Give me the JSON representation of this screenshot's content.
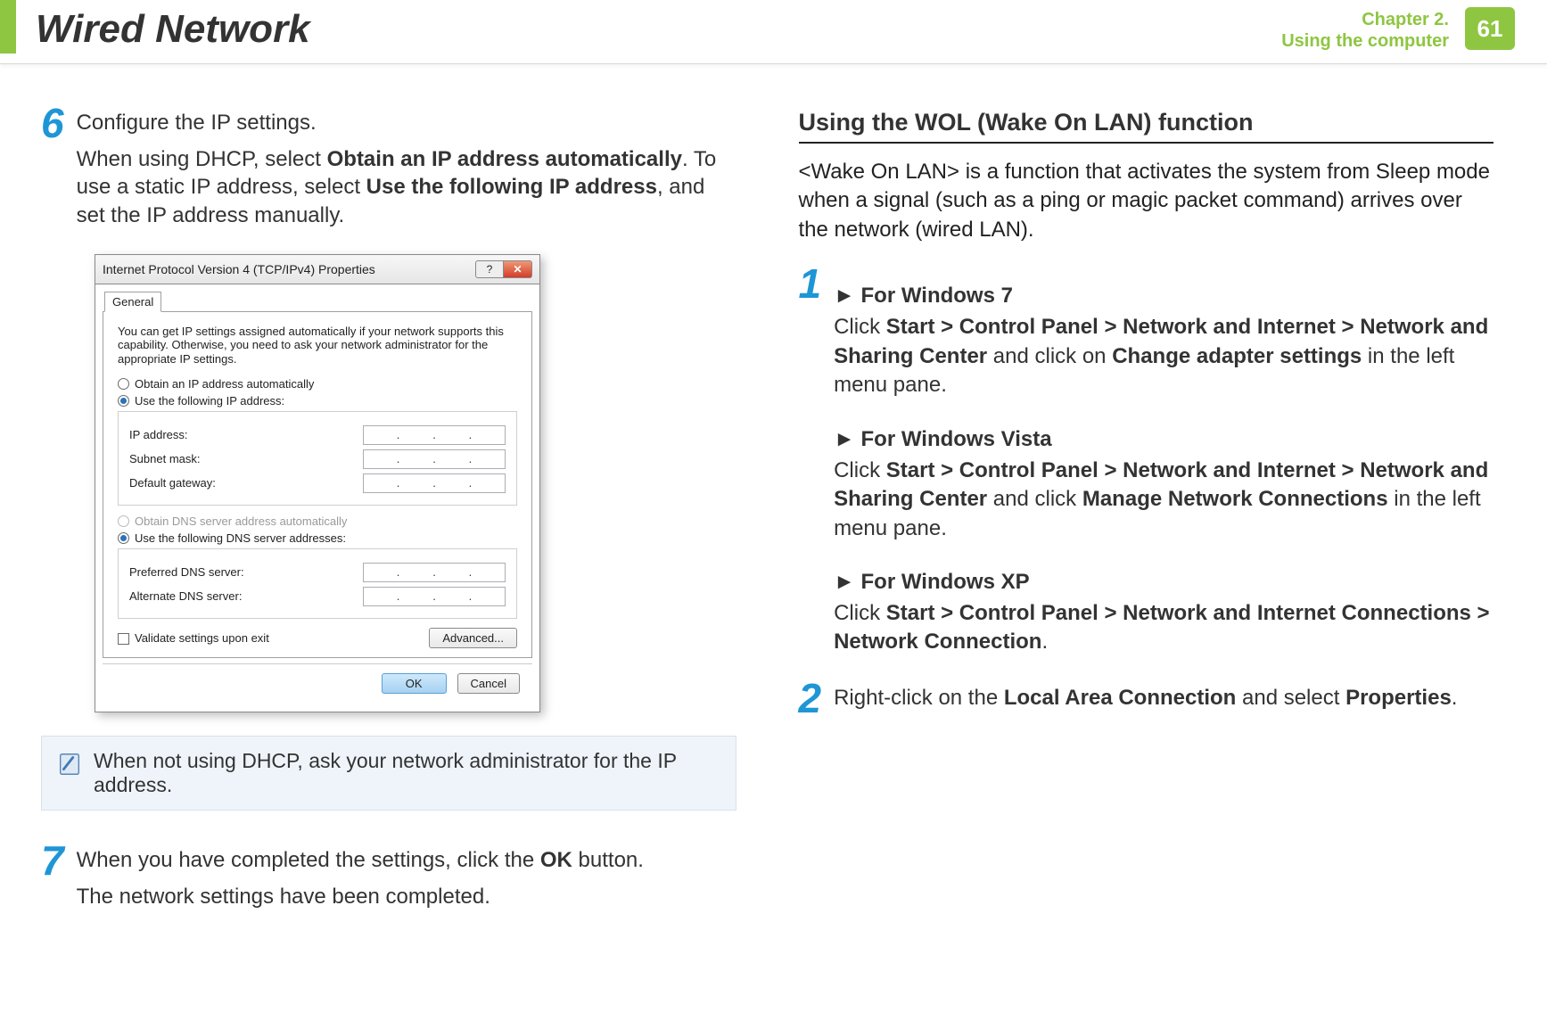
{
  "header": {
    "title": "Wired Network",
    "chapter_line1": "Chapter 2.",
    "chapter_line2": "Using the computer",
    "page_number": "61"
  },
  "left_col": {
    "step6": {
      "num": "6",
      "line1": "Configure the IP settings.",
      "line2_a": "When using DHCP, select ",
      "line2_b": "Obtain an IP address automatically",
      "line2_c": ". To use a static IP address, select ",
      "line2_d": "Use the following IP address",
      "line2_e": ", and set the IP address manually."
    },
    "dialog": {
      "title": "Internet Protocol Version 4 (TCP/IPv4) Properties",
      "help_symbol": "?",
      "close_symbol": "✕",
      "tab": "General",
      "intro": "You can get IP settings assigned automatically if your network supports this capability. Otherwise, you need to ask your network administrator for the appropriate IP settings.",
      "radio1": "Obtain an IP address automatically",
      "radio2": "Use the following IP address:",
      "ip_label": "IP address:",
      "subnet_label": "Subnet mask:",
      "gateway_label": "Default gateway:",
      "dns_auto": "Obtain DNS server address automatically",
      "dns_manual": "Use the following DNS server addresses:",
      "pref_dns": "Preferred DNS server:",
      "alt_dns": "Alternate DNS server:",
      "validate": "Validate settings upon exit",
      "advanced": "Advanced...",
      "ok": "OK",
      "cancel": "Cancel"
    },
    "note": "When not using DHCP, ask your network administrator for the IP address.",
    "step7": {
      "num": "7",
      "a": "When you have completed the settings, click the ",
      "b": "OK",
      "c": " button.",
      "d": "The network settings have been completed."
    }
  },
  "right_col": {
    "heading": "Using the WOL (Wake On LAN) function",
    "intro": "<Wake On LAN> is a function that activates the system from Sleep mode when a signal (such as a ping or magic packet command) arrives over the network (wired LAN).",
    "step1": {
      "num": "1",
      "win7_head": "► For Windows 7",
      "win7_a": "Click ",
      "win7_b": "Start > Control Panel > Network and Internet > Network and Sharing Center",
      "win7_c": " and click on ",
      "win7_d": "Change adapter settings",
      "win7_e": " in the left menu pane.",
      "vista_head": "► For Windows Vista",
      "vista_a": "Click ",
      "vista_b": "Start > Control Panel > Network and Internet > Network and Sharing Center",
      "vista_c": " and click ",
      "vista_d": "Manage Network Connections",
      "vista_e": " in the left menu pane.",
      "xp_head": "► For Windows XP",
      "xp_a": "Click ",
      "xp_b": "Start > Control Panel > Network and Internet Connections > Network Connection",
      "xp_c": "."
    },
    "step2": {
      "num": "2",
      "a": "Right-click on the ",
      "b": "Local Area Connection",
      "c": " and select ",
      "d": "Properties",
      "e": "."
    }
  }
}
